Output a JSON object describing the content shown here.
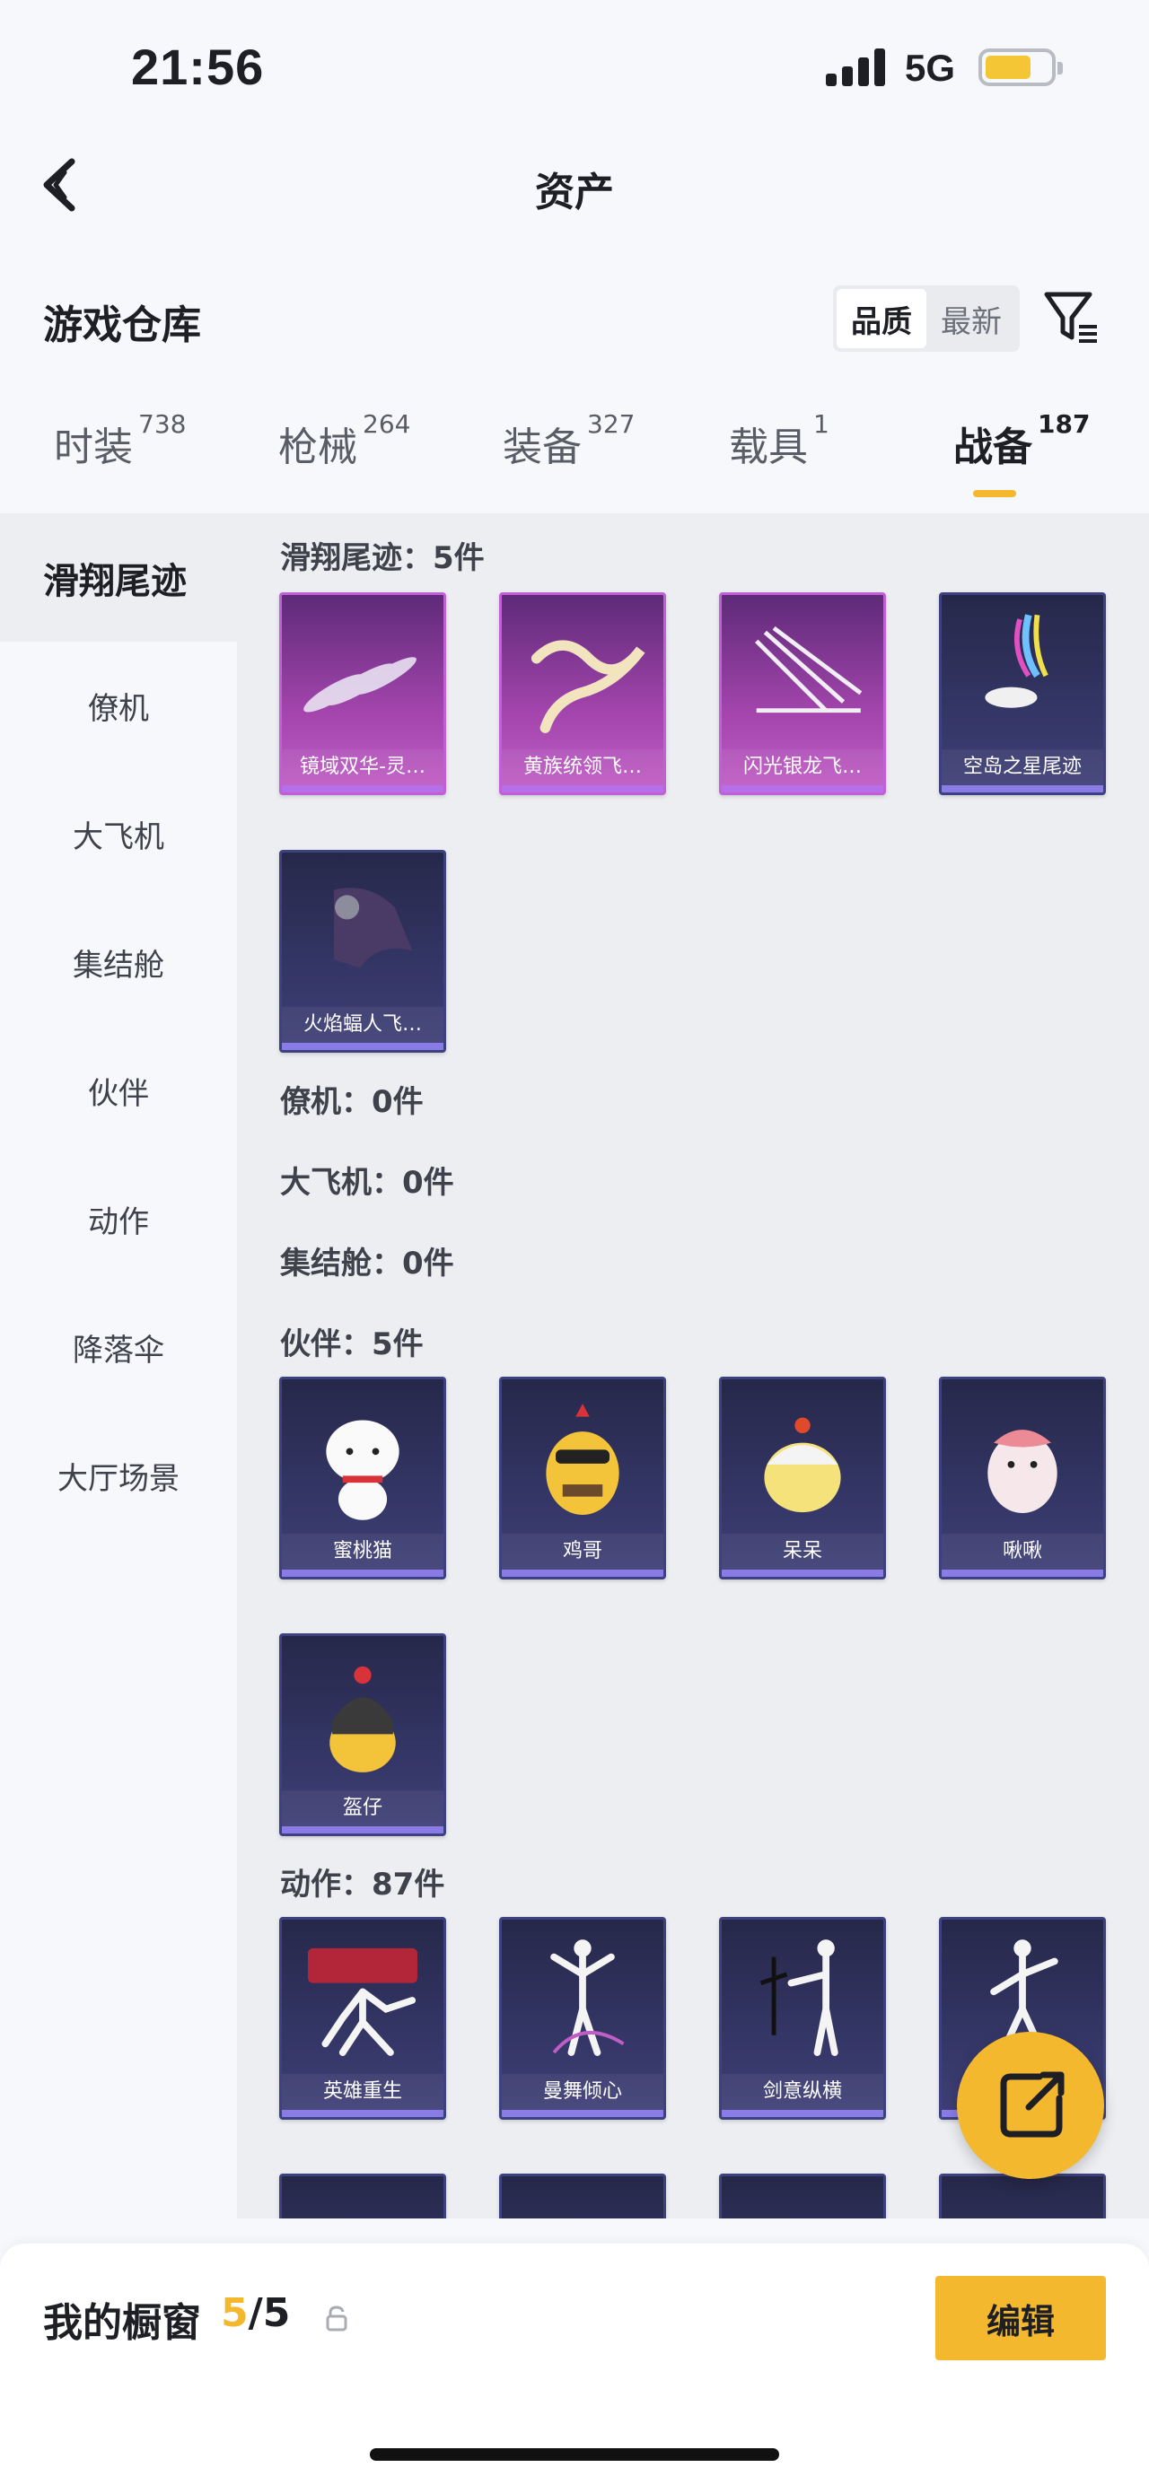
{
  "status_bar": {
    "time": "21:56",
    "network": "5G"
  },
  "nav": {
    "title": "资产"
  },
  "header": {
    "section_title": "游戏仓库",
    "sort_options": [
      "品质",
      "最新"
    ]
  },
  "tabs": [
    {
      "label": "时装",
      "count": "738"
    },
    {
      "label": "枪械",
      "count": "264"
    },
    {
      "label": "装备",
      "count": "327"
    },
    {
      "label": "载具",
      "count": "1"
    },
    {
      "label": "战备",
      "count": "187"
    }
  ],
  "sidebar": {
    "items": [
      "滑翔尾迹",
      "僚机",
      "大飞机",
      "集结舱",
      "伙伴",
      "动作",
      "降落伞",
      "大厅场景"
    ]
  },
  "groups": {
    "glide": {
      "title": "滑翔尾迹：5件",
      "items": [
        "镜域双华-灵…",
        "黄族统领飞…",
        "闪光银龙飞…",
        "空岛之星尾迹",
        "火焰蝠人飞…"
      ]
    },
    "wingman": {
      "title": "僚机：0件"
    },
    "big_plane": {
      "title": "大飞机：0件"
    },
    "pod": {
      "title": "集结舱：0件"
    },
    "partner": {
      "title": "伙伴：5件",
      "items": [
        "蜜桃猫",
        "鸡哥",
        "呆呆",
        "啾啾",
        "盔仔"
      ]
    },
    "emote": {
      "title": "动作：87件",
      "items": [
        "英雄重生",
        "曼舞倾心",
        "剑意纵横"
      ]
    }
  },
  "bottom": {
    "showcase_label": "我的橱窗",
    "showcase_current": "5",
    "showcase_total": "/5",
    "edit_label": "编辑"
  },
  "colors": {
    "accent": "#f4b82e",
    "card_purple": "#a345ad",
    "card_blue": "#343666"
  }
}
